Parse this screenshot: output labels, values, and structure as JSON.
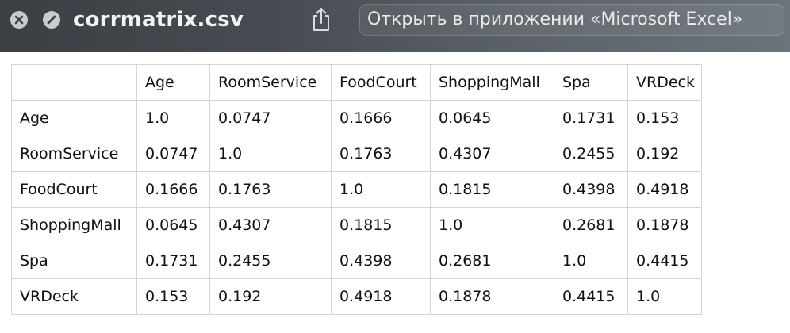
{
  "window": {
    "title": "corrmatrix.csv",
    "open_button_label": "Открыть в приложении «Microsoft Excel»"
  },
  "icons": {
    "close": "close-x-icon",
    "hide": "slash-circle-icon",
    "share": "share-icon"
  },
  "table": {
    "columns": [
      "",
      "Age",
      "RoomService",
      "FoodCourt",
      "ShoppingMall",
      "Spa",
      "VRDeck"
    ],
    "rows": [
      [
        "Age",
        "1.0",
        "0.0747",
        "0.1666",
        "0.0645",
        "0.1731",
        "0.153"
      ],
      [
        "RoomService",
        "0.0747",
        "1.0",
        "0.1763",
        "0.4307",
        "0.2455",
        "0.192"
      ],
      [
        "FoodCourt",
        "0.1666",
        "0.1763",
        "1.0",
        "0.1815",
        "0.4398",
        "0.4918"
      ],
      [
        "ShoppingMall",
        "0.0645",
        "0.4307",
        "0.1815",
        "1.0",
        "0.2681",
        "0.1878"
      ],
      [
        "Spa",
        "0.1731",
        "0.2455",
        "0.4398",
        "0.2681",
        "1.0",
        "0.4415"
      ],
      [
        "VRDeck",
        "0.153",
        "0.192",
        "0.4918",
        "0.1878",
        "0.4415",
        "1.0"
      ]
    ]
  }
}
